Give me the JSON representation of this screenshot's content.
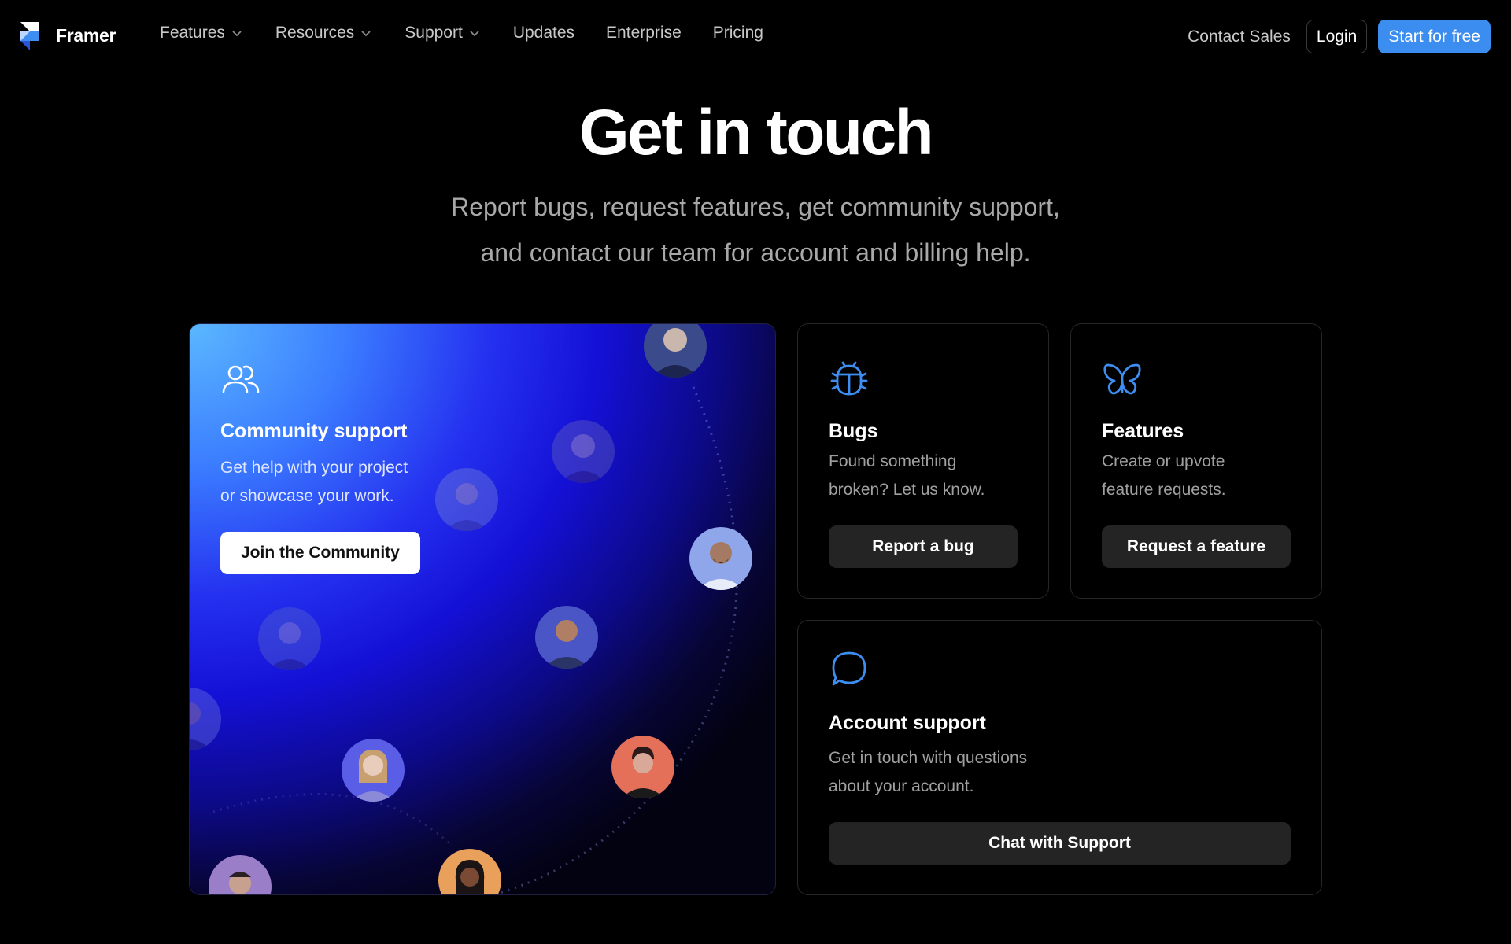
{
  "nav": {
    "brand": "Framer",
    "links": [
      {
        "label": "Features",
        "dropdown": true
      },
      {
        "label": "Resources",
        "dropdown": true
      },
      {
        "label": "Support",
        "dropdown": true
      },
      {
        "label": "Updates",
        "dropdown": false
      },
      {
        "label": "Enterprise",
        "dropdown": false
      },
      {
        "label": "Pricing",
        "dropdown": false
      }
    ],
    "contact_sales": "Contact Sales",
    "login": "Login",
    "start": "Start for free"
  },
  "hero": {
    "title": "Get in touch",
    "subtitle_line1": "Report bugs, request features, get community support,",
    "subtitle_line2": "and contact our team for account and billing help."
  },
  "community": {
    "icon": "users-icon",
    "title": "Community support",
    "desc_line1": "Get help with your project",
    "desc_line2": "or showcase your work.",
    "button": "Join the Community"
  },
  "bugs": {
    "icon": "bug-icon",
    "title": "Bugs",
    "desc_line1": "Found something",
    "desc_line2": "broken? Let us know.",
    "button": "Report a bug"
  },
  "features": {
    "icon": "butterfly-icon",
    "title": "Features",
    "desc_line1": "Create or upvote",
    "desc_line2": "feature requests.",
    "button": "Request a feature"
  },
  "account": {
    "icon": "chat-bubble-icon",
    "title": "Account support",
    "desc_line1": "Get in touch with questions",
    "desc_line2": "about your account.",
    "button": "Chat with Support"
  },
  "colors": {
    "background": "#000000",
    "accent": "#3b8ef0",
    "card_border": "#262626",
    "button_dark": "#242424",
    "icon_blue": "#3e8ef2"
  }
}
